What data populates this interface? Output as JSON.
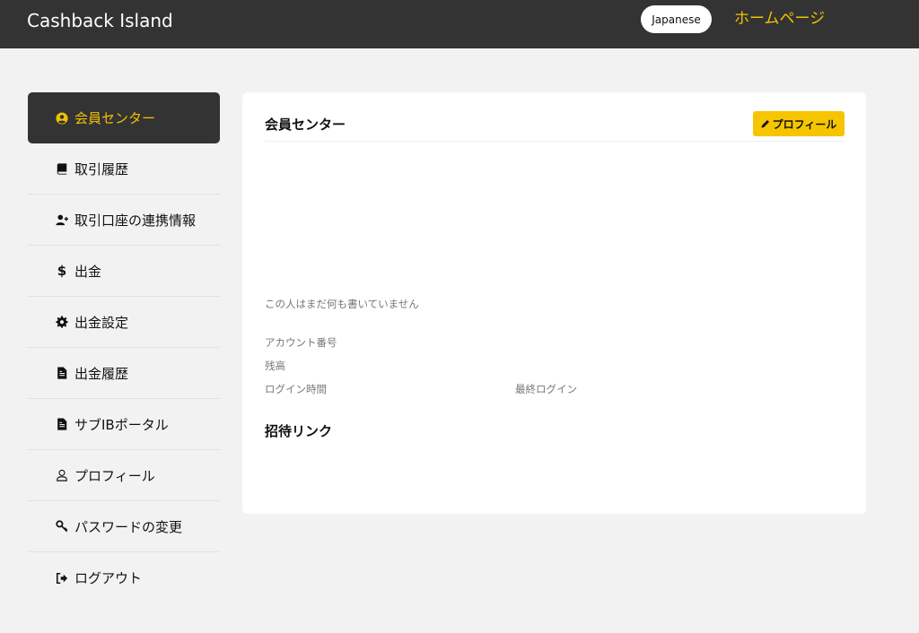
{
  "header": {
    "brand": "Cashback Island",
    "language_button": "Japanese",
    "home_link": "ホームページ"
  },
  "sidebar": {
    "items": [
      {
        "label": "会員センター",
        "icon": "user-circle-icon",
        "active": true
      },
      {
        "label": "取引履歴",
        "icon": "book-icon"
      },
      {
        "label": "取引口座の連携情報",
        "icon": "user-plus-icon"
      },
      {
        "label": "出金",
        "icon": "dollar-icon"
      },
      {
        "label": "出金設定",
        "icon": "gear-icon"
      },
      {
        "label": "出金履歴",
        "icon": "document-icon"
      },
      {
        "label": "サブIBポータル",
        "icon": "document-icon"
      },
      {
        "label": "プロフィール",
        "icon": "user-outline-icon"
      },
      {
        "label": "パスワードの変更",
        "icon": "key-icon"
      },
      {
        "label": "ログアウト",
        "icon": "logout-icon"
      }
    ]
  },
  "main": {
    "title": "会員センター",
    "profile_button": "プロフィール",
    "bio": "この人はまだ何も書いていません",
    "account_number_label": "アカウント番号",
    "balance_label": "残高",
    "login_time_label": "ログイン時間",
    "last_login_label": "最終ログイン",
    "invite_link_title": "招待リンク"
  },
  "colors": {
    "accent": "#f7c500",
    "header_bg": "#333333",
    "page_bg": "#f2f2f2"
  }
}
